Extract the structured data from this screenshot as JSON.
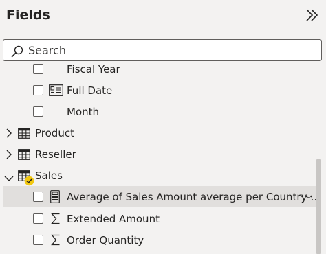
{
  "panel": {
    "title": "Fields",
    "collapse_icon": "double-chevron-right-icon"
  },
  "search": {
    "placeholder": "Search",
    "value": ""
  },
  "tree": {
    "items": [
      {
        "kind": "field",
        "label": "Fiscal Year",
        "icon": "none",
        "checked": false
      },
      {
        "kind": "field",
        "label": "Full Date",
        "icon": "date-field-icon",
        "checked": false
      },
      {
        "kind": "field",
        "label": "Month",
        "icon": "none",
        "checked": false
      },
      {
        "kind": "table",
        "label": "Product",
        "icon": "table-icon",
        "expanded": false
      },
      {
        "kind": "table",
        "label": "Reseller",
        "icon": "table-icon",
        "expanded": false
      },
      {
        "kind": "table",
        "label": "Sales",
        "icon": "table-icon",
        "expanded": true,
        "badge": "checkmark-badge-icon"
      },
      {
        "kind": "measure",
        "label": "Average of Sales Amount average per Country-...",
        "icon": "calculator-icon",
        "checked": false,
        "selected": true,
        "more": "···"
      },
      {
        "kind": "field",
        "label": "Extended Amount",
        "icon": "sigma-icon",
        "checked": false
      },
      {
        "kind": "field",
        "label": "Order Quantity",
        "icon": "sigma-icon",
        "checked": false
      }
    ]
  },
  "colors": {
    "background": "#f3f2f1",
    "selected_row": "#e1dfdd",
    "badge": "#f2c811",
    "text": "#252423"
  }
}
